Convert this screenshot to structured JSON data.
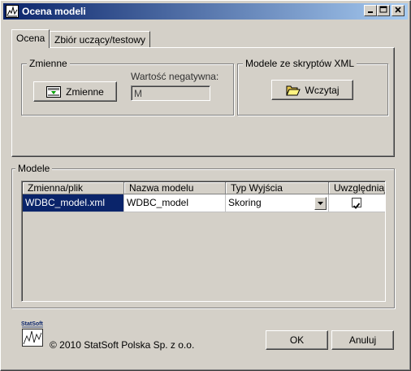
{
  "window": {
    "title": "Ocena modeli",
    "minimize_icon": "minimize-icon",
    "maximize_icon": "maximize-icon",
    "close_icon": "close-icon"
  },
  "tabs": [
    {
      "label": "Ocena",
      "active": true
    },
    {
      "label": "Zbiór uczący/testowy",
      "active": false
    }
  ],
  "zmienne_group": {
    "title": "Zmienne",
    "button_label": "Zmienne",
    "button_icon": "variables-icon",
    "negative_label": "Wartość negatywna:",
    "negative_value": "M"
  },
  "xml_group": {
    "title": "Modele ze skryptów XML",
    "button_label": "Wczytaj",
    "button_icon": "open-folder-icon"
  },
  "models": {
    "title": "Modele",
    "columns": [
      "Zmienna/plik",
      "Nazwa modelu",
      "Typ Wyjścia",
      "Uwzględniaj"
    ],
    "rows": [
      {
        "file": "WDBC_model.xml",
        "name": "WDBC_model",
        "output_type": "Skoring",
        "include": true
      }
    ]
  },
  "footer": {
    "logo_text": "StatSoft",
    "copyright": "© 2010 StatSoft Polska Sp. z o.o.",
    "ok_label": "OK",
    "cancel_label": "Anuluj"
  },
  "colors": {
    "face": "#d4d0c8",
    "title_start": "#0a246a",
    "title_end": "#a6caf0",
    "selection": "#0a246a"
  }
}
